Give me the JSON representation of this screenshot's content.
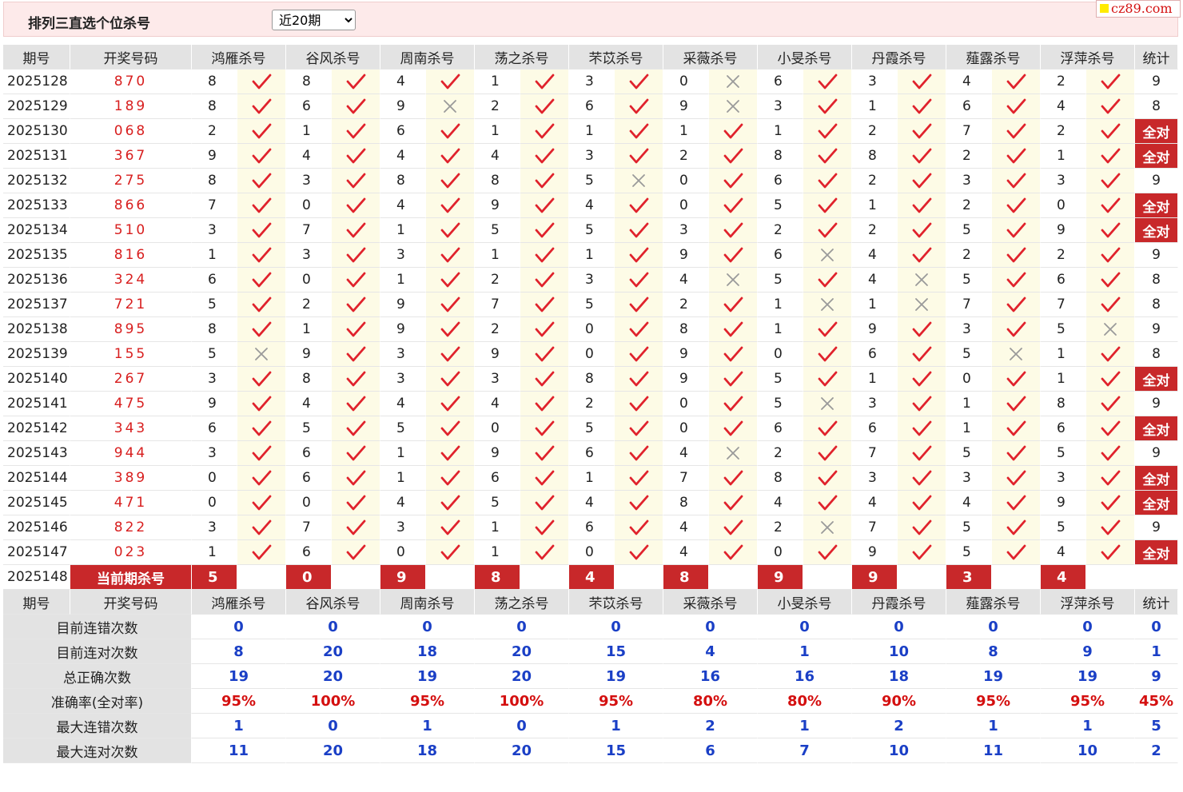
{
  "header": {
    "title": "排列三直选个位杀号",
    "period_select": "近20期",
    "logo_text": "cz89.com"
  },
  "columns": {
    "issue": "期号",
    "draw": "开奖号码",
    "predictors": [
      "鸿雁杀号",
      "谷风杀号",
      "周南杀号",
      "荡之杀号",
      "芣苡杀号",
      "采薇杀号",
      "小旻杀号",
      "丹霞杀号",
      "薤露杀号",
      "浮萍杀号"
    ],
    "stat": "统计"
  },
  "all_correct_label": "全对",
  "rows": [
    {
      "issue": "2025128",
      "draw": "870",
      "kills": [
        8,
        8,
        4,
        1,
        3,
        0,
        6,
        3,
        4,
        2
      ],
      "hits": [
        1,
        1,
        1,
        1,
        1,
        0,
        1,
        1,
        1,
        1
      ],
      "stat": "9"
    },
    {
      "issue": "2025129",
      "draw": "189",
      "kills": [
        8,
        6,
        9,
        2,
        6,
        9,
        3,
        1,
        6,
        4
      ],
      "hits": [
        1,
        1,
        0,
        1,
        1,
        0,
        1,
        1,
        1,
        1
      ],
      "stat": "8"
    },
    {
      "issue": "2025130",
      "draw": "068",
      "kills": [
        2,
        1,
        6,
        1,
        1,
        1,
        1,
        2,
        7,
        2
      ],
      "hits": [
        1,
        1,
        1,
        1,
        1,
        1,
        1,
        1,
        1,
        1
      ],
      "stat": "全对"
    },
    {
      "issue": "2025131",
      "draw": "367",
      "kills": [
        9,
        4,
        4,
        4,
        3,
        2,
        8,
        8,
        2,
        1
      ],
      "hits": [
        1,
        1,
        1,
        1,
        1,
        1,
        1,
        1,
        1,
        1
      ],
      "stat": "全对"
    },
    {
      "issue": "2025132",
      "draw": "275",
      "kills": [
        8,
        3,
        8,
        8,
        5,
        0,
        6,
        2,
        3,
        3
      ],
      "hits": [
        1,
        1,
        1,
        1,
        0,
        1,
        1,
        1,
        1,
        1
      ],
      "stat": "9"
    },
    {
      "issue": "2025133",
      "draw": "866",
      "kills": [
        7,
        0,
        4,
        9,
        4,
        0,
        5,
        1,
        2,
        0
      ],
      "hits": [
        1,
        1,
        1,
        1,
        1,
        1,
        1,
        1,
        1,
        1
      ],
      "stat": "全对"
    },
    {
      "issue": "2025134",
      "draw": "510",
      "kills": [
        3,
        7,
        1,
        5,
        5,
        3,
        2,
        2,
        5,
        9
      ],
      "hits": [
        1,
        1,
        1,
        1,
        1,
        1,
        1,
        1,
        1,
        1
      ],
      "stat": "全对"
    },
    {
      "issue": "2025135",
      "draw": "816",
      "kills": [
        1,
        3,
        3,
        1,
        1,
        9,
        6,
        4,
        2,
        2
      ],
      "hits": [
        1,
        1,
        1,
        1,
        1,
        1,
        0,
        1,
        1,
        1
      ],
      "stat": "9"
    },
    {
      "issue": "2025136",
      "draw": "324",
      "kills": [
        6,
        0,
        1,
        2,
        3,
        4,
        5,
        4,
        5,
        6
      ],
      "hits": [
        1,
        1,
        1,
        1,
        1,
        0,
        1,
        0,
        1,
        1
      ],
      "stat": "8"
    },
    {
      "issue": "2025137",
      "draw": "721",
      "kills": [
        5,
        2,
        9,
        7,
        5,
        2,
        1,
        1,
        7,
        7
      ],
      "hits": [
        1,
        1,
        1,
        1,
        1,
        1,
        0,
        0,
        1,
        1
      ],
      "stat": "8"
    },
    {
      "issue": "2025138",
      "draw": "895",
      "kills": [
        8,
        1,
        9,
        2,
        0,
        8,
        1,
        9,
        3,
        5
      ],
      "hits": [
        1,
        1,
        1,
        1,
        1,
        1,
        1,
        1,
        1,
        0
      ],
      "stat": "9"
    },
    {
      "issue": "2025139",
      "draw": "155",
      "kills": [
        5,
        9,
        3,
        9,
        0,
        9,
        0,
        6,
        5,
        1
      ],
      "hits": [
        0,
        1,
        1,
        1,
        1,
        1,
        1,
        1,
        0,
        1
      ],
      "stat": "8"
    },
    {
      "issue": "2025140",
      "draw": "267",
      "kills": [
        3,
        8,
        3,
        3,
        8,
        9,
        5,
        1,
        0,
        1
      ],
      "hits": [
        1,
        1,
        1,
        1,
        1,
        1,
        1,
        1,
        1,
        1
      ],
      "stat": "全对"
    },
    {
      "issue": "2025141",
      "draw": "475",
      "kills": [
        9,
        4,
        4,
        4,
        2,
        0,
        5,
        3,
        1,
        8
      ],
      "hits": [
        1,
        1,
        1,
        1,
        1,
        1,
        0,
        1,
        1,
        1
      ],
      "stat": "9"
    },
    {
      "issue": "2025142",
      "draw": "343",
      "kills": [
        6,
        5,
        5,
        0,
        5,
        0,
        6,
        6,
        1,
        6
      ],
      "hits": [
        1,
        1,
        1,
        1,
        1,
        1,
        1,
        1,
        1,
        1
      ],
      "stat": "全对"
    },
    {
      "issue": "2025143",
      "draw": "944",
      "kills": [
        3,
        6,
        1,
        9,
        6,
        4,
        2,
        7,
        5,
        5
      ],
      "hits": [
        1,
        1,
        1,
        1,
        1,
        0,
        1,
        1,
        1,
        1
      ],
      "stat": "9"
    },
    {
      "issue": "2025144",
      "draw": "389",
      "kills": [
        0,
        6,
        1,
        6,
        1,
        7,
        8,
        3,
        3,
        3
      ],
      "hits": [
        1,
        1,
        1,
        1,
        1,
        1,
        1,
        1,
        1,
        1
      ],
      "stat": "全对"
    },
    {
      "issue": "2025145",
      "draw": "471",
      "kills": [
        0,
        0,
        4,
        5,
        4,
        8,
        4,
        4,
        4,
        9
      ],
      "hits": [
        1,
        1,
        1,
        1,
        1,
        1,
        1,
        1,
        1,
        1
      ],
      "stat": "全对"
    },
    {
      "issue": "2025146",
      "draw": "822",
      "kills": [
        3,
        7,
        3,
        1,
        6,
        4,
        2,
        7,
        5,
        5
      ],
      "hits": [
        1,
        1,
        1,
        1,
        1,
        1,
        0,
        1,
        1,
        1
      ],
      "stat": "9"
    },
    {
      "issue": "2025147",
      "draw": "023",
      "kills": [
        1,
        6,
        0,
        1,
        0,
        4,
        0,
        9,
        5,
        4
      ],
      "hits": [
        1,
        1,
        1,
        1,
        1,
        1,
        1,
        1,
        1,
        1
      ],
      "stat": "全对"
    }
  ],
  "current": {
    "issue": "2025148",
    "label": "当前期杀号",
    "kills": [
      5,
      0,
      9,
      8,
      4,
      8,
      9,
      9,
      3,
      4
    ]
  },
  "summary": [
    {
      "label": "目前连错次数",
      "values": [
        "0",
        "0",
        "0",
        "0",
        "0",
        "0",
        "0",
        "0",
        "0",
        "0"
      ],
      "stat": "0"
    },
    {
      "label": "目前连对次数",
      "values": [
        "8",
        "20",
        "18",
        "20",
        "15",
        "4",
        "1",
        "10",
        "8",
        "9"
      ],
      "stat": "1"
    },
    {
      "label": "总正确次数",
      "values": [
        "19",
        "20",
        "19",
        "20",
        "19",
        "16",
        "16",
        "18",
        "19",
        "19"
      ],
      "stat": "9"
    },
    {
      "label": "准确率(全对率)",
      "values": [
        "95%",
        "100%",
        "95%",
        "100%",
        "95%",
        "80%",
        "80%",
        "90%",
        "95%",
        "95%"
      ],
      "stat": "45%",
      "pct": true
    },
    {
      "label": "最大连错次数",
      "values": [
        "1",
        "0",
        "1",
        "0",
        "1",
        "2",
        "1",
        "2",
        "1",
        "1"
      ],
      "stat": "5"
    },
    {
      "label": "最大连对次数",
      "values": [
        "11",
        "20",
        "18",
        "20",
        "15",
        "6",
        "7",
        "10",
        "11",
        "10"
      ],
      "stat": "2"
    }
  ],
  "colors": {
    "accent_red": "#c8282a",
    "blue_value": "#1a3fc6",
    "check_red": "#e0222c",
    "cross_gray": "#9a9a9a",
    "result_bg": "#fdfbe6",
    "header_gray": "#e3e3e3"
  }
}
